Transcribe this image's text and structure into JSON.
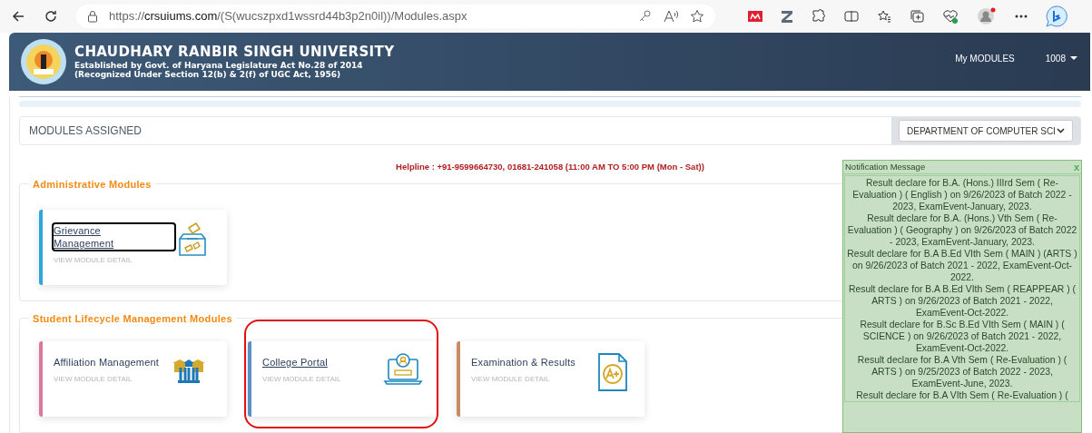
{
  "browser": {
    "url_scheme": "https://",
    "url_host": "crsuiums.com",
    "url_path": "/(S(wucszpxd1wssrd44b3p2n0il))/Modules.aspx",
    "profile_notification": true
  },
  "header": {
    "title": "CHAUDHARY RANBIR SINGH UNIVERSITY",
    "subtitle_1": "Established by Govt. of Haryana Legislature Act No.28 of 2014",
    "subtitle_2": "(Recognized Under Section 12(b) & 2(f) of UGC Act, 1956)",
    "nav": [
      {
        "label": "My MODULES",
        "kind": "link"
      },
      {
        "label": "1008",
        "kind": "dropdown"
      }
    ]
  },
  "modules_bar": {
    "title": "MODULES ASSIGNED",
    "department": "DEPARTMENT OF COMPUTER SCI"
  },
  "helpline": "Helpline : +91-9599664730, 01681-241058 (11:00 AM TO 5:00 PM (Mon - Sat))",
  "sections": [
    {
      "title": "Administrative Modules",
      "cards": [
        {
          "title": "Grievance Management",
          "detail": "VIEW MODULE DETAIL",
          "color": "#2ea7d8",
          "focused": true,
          "highlighted": false
        }
      ]
    },
    {
      "title": "Student Lifecycle Management Modules",
      "cards": [
        {
          "title": "Affiliation Management",
          "detail": "VIEW MODULE DETAIL",
          "color": "#d9799b",
          "focused": false,
          "highlighted": false
        },
        {
          "title": "College Portal",
          "detail": "VIEW MODULE DETAIL",
          "color": "#5b8fc8",
          "focused": false,
          "highlighted": true
        },
        {
          "title": "Examination & Results",
          "detail": "VIEW MODULE DETAIL",
          "color": "#c98b66",
          "focused": false,
          "highlighted": false
        }
      ]
    }
  ],
  "notification": {
    "title": "Notification Message",
    "close": "x",
    "messages": [
      "Result declare for B.A. (Hons.) IIIrd Sem ( Re-Evaluation ) ( English ) on 9/26/2023 of Batch 2022 - 2023, ExamEvent-January, 2023.",
      "Result declare for B.A. (Hons.) Vth Sem ( Re-Evaluation ) ( Geography ) on 9/26/2023 of Batch 2022 - 2023, ExamEvent-January, 2023.",
      "Result declare for B.A B.Ed VIth Sem ( MAIN ) (ARTS ) on 9/26/2023 of Batch 2021 - 2022, ExamEvent-Oct-2022.",
      "Result declare for B.A B.Ed VIth Sem ( REAPPEAR ) ( ARTS ) on 9/26/2023 of Batch 2021 - 2022, ExamEvent-Oct-2022.",
      "Result declare for B.Sc B.Ed VIth Sem ( MAIN ) ( SCIENCE ) on 9/26/2023 of Batch 2021 - 2022, ExamEvent-Oct-2022.",
      "Result declare for B.A Vth Sem ( Re-Evaluation ) ( ARTS ) on 9/25/2023 of Batch 2022 - 2023, ExamEvent-June, 2023.",
      "Result declare for B.A VIth Sem ( Re-Evaluation ) ("
    ]
  }
}
